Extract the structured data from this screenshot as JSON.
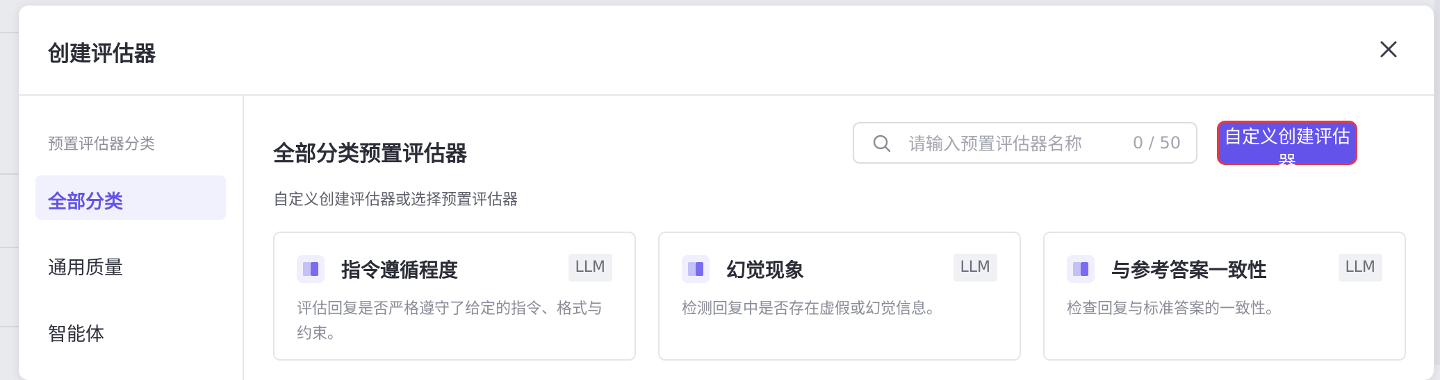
{
  "dialog": {
    "title": "创建评估器"
  },
  "sidebar": {
    "label": "预置评估器分类",
    "items": [
      {
        "label": "全部分类",
        "active": true
      },
      {
        "label": "通用质量",
        "active": false
      },
      {
        "label": "智能体",
        "active": false
      }
    ]
  },
  "main": {
    "title": "全部分类预置评估器",
    "subtitle": "自定义创建评估器或选择预置评估器",
    "search": {
      "placeholder": "请输入预置评估器名称",
      "value": "",
      "count": "0 / 50"
    },
    "create_button": "自定义创建评估器",
    "cards": [
      {
        "title": "指令遵循程度",
        "badge": "LLM",
        "description": "评估回复是否严格遵守了给定的指令、格式与约束。"
      },
      {
        "title": "幻觉现象",
        "badge": "LLM",
        "description": "检测回复中是否存在虚假或幻觉信息。"
      },
      {
        "title": "与参考答案一致性",
        "badge": "LLM",
        "description": "检查回复与标准答案的一致性。"
      }
    ]
  },
  "colors": {
    "accent": "#6453ea",
    "highlight_border": "#e33a47",
    "active_bg": "#f1f0fd"
  }
}
